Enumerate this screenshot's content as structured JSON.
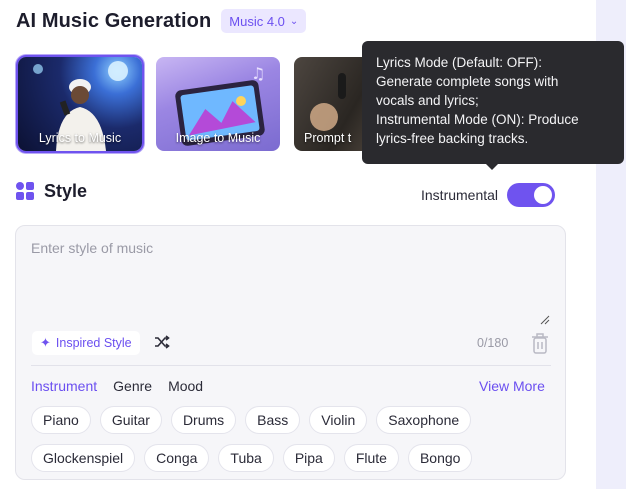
{
  "header": {
    "title": "AI Music Generation",
    "version": "Music 4.0"
  },
  "modes": [
    {
      "label": "Lyrics to Music",
      "active": true
    },
    {
      "label": "Image to Music",
      "active": false
    },
    {
      "label": "Prompt t",
      "active": false
    }
  ],
  "tooltip": {
    "lines": [
      "Lyrics Mode (Default: OFF):",
      "Generate complete songs with",
      "vocals and lyrics;",
      "Instrumental Mode (ON): Produce",
      "lyrics-free backing tracks."
    ]
  },
  "style": {
    "title": "Style",
    "instrumental_label": "Instrumental",
    "instrumental_on": true,
    "placeholder": "Enter style of music",
    "inspired_label": "Inspired Style",
    "counter": "0/180",
    "tabs": [
      "Instrument",
      "Genre",
      "Mood"
    ],
    "active_tab": "Instrument",
    "view_more": "View More",
    "chips_row1": [
      "Piano",
      "Guitar",
      "Drums",
      "Bass",
      "Violin",
      "Saxophone"
    ],
    "chips_row2": [
      "Glockenspiel",
      "Conga",
      "Tuba",
      "Pipa",
      "Flute",
      "Bongo"
    ]
  },
  "colors": {
    "accent": "#6f53ef",
    "tooltip_bg": "#2a2a2e"
  }
}
